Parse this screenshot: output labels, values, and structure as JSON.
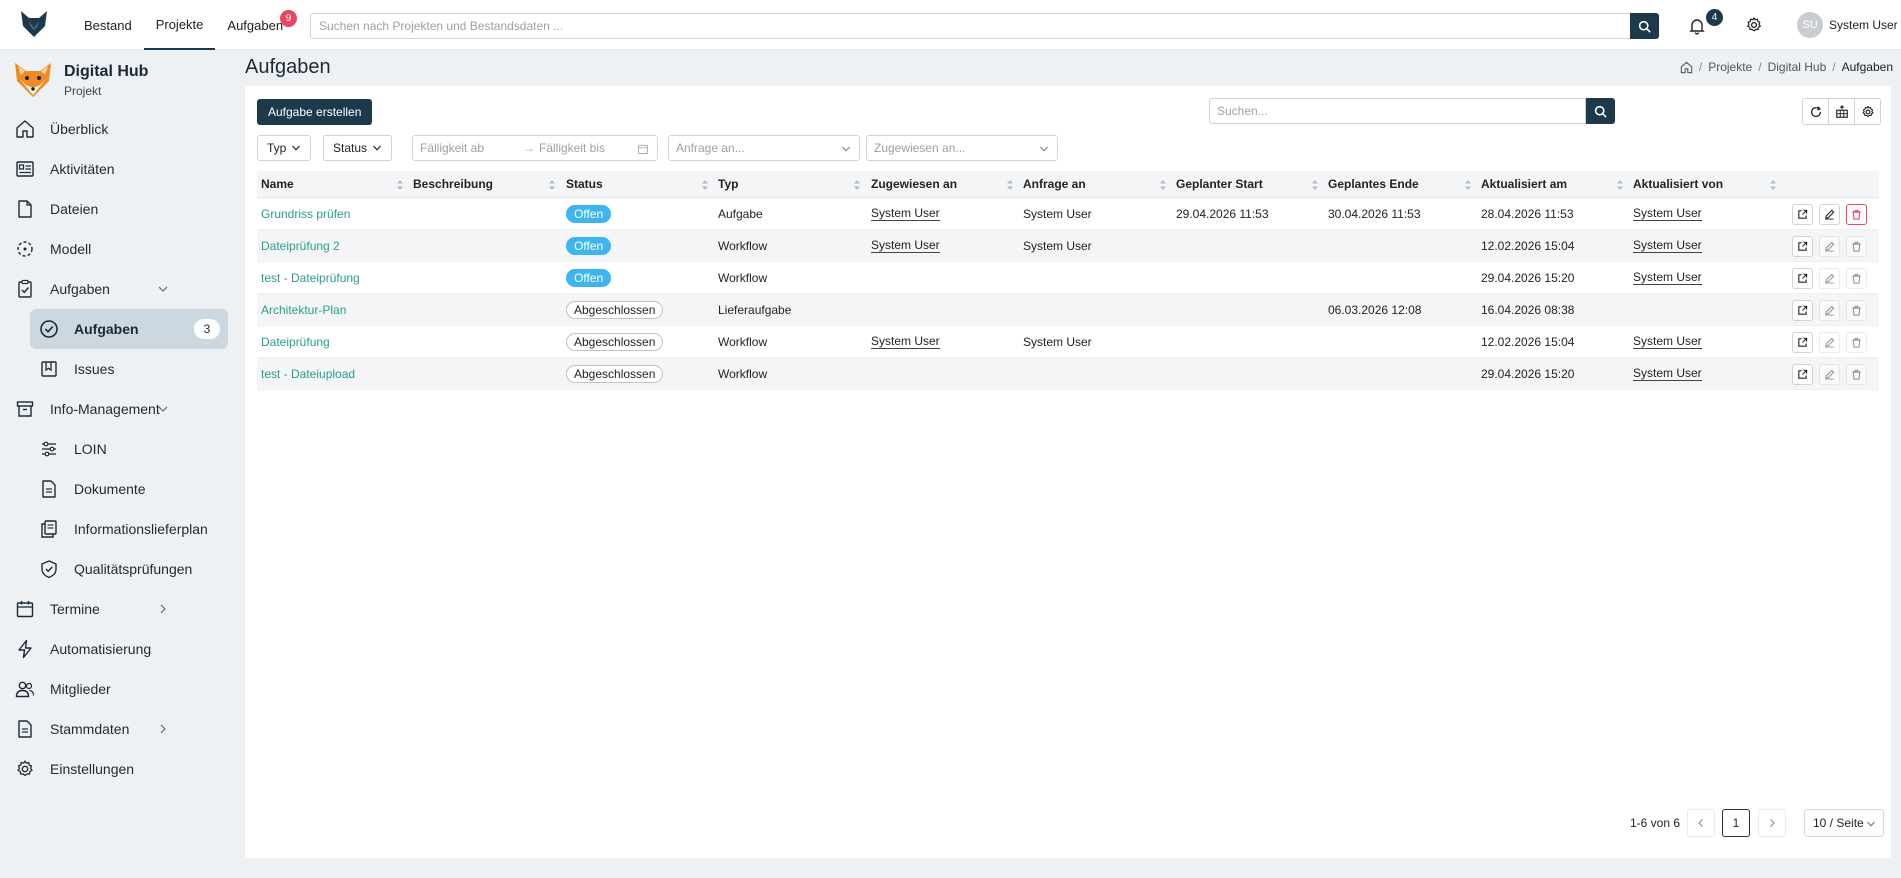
{
  "topnav": {
    "items": [
      {
        "label": "Bestand"
      },
      {
        "label": "Projekte",
        "active": true
      },
      {
        "label": "Aufgaben",
        "badge": "9"
      }
    ],
    "search_placeholder": "Suchen nach Projekten und Bestandsdaten ...",
    "notifications_count": "4",
    "user_initials": "SU",
    "user_name": "System User"
  },
  "project": {
    "title": "Digital Hub",
    "subtitle": "Projekt"
  },
  "sidebar": {
    "items": [
      {
        "label": "Überblick",
        "icon": "home-icon"
      },
      {
        "label": "Aktivitäten",
        "icon": "activity-icon"
      },
      {
        "label": "Dateien",
        "icon": "file-icon"
      },
      {
        "label": "Modell",
        "icon": "model-icon"
      },
      {
        "label": "Aufgaben",
        "icon": "clipboard-check-icon",
        "expanded": true
      },
      {
        "label": "Aufgaben",
        "icon": "check-circle-icon",
        "selected": true,
        "count": "3"
      },
      {
        "label": "Issues",
        "icon": "bookmark-icon"
      },
      {
        "label": "Info-Management",
        "icon": "archive-icon",
        "expanded": true
      },
      {
        "label": "LOIN",
        "icon": "sliders-icon"
      },
      {
        "label": "Dokumente",
        "icon": "document-icon"
      },
      {
        "label": "Informationslieferplan",
        "icon": "copy-icon"
      },
      {
        "label": "Qualitätsprüfungen",
        "icon": "shield-check-icon"
      },
      {
        "label": "Termine",
        "icon": "calendar-icon"
      },
      {
        "label": "Automatisierung",
        "icon": "bolt-icon"
      },
      {
        "label": "Mitglieder",
        "icon": "users-icon"
      },
      {
        "label": "Stammdaten",
        "icon": "document-icon"
      },
      {
        "label": "Einstellungen",
        "icon": "gear-icon"
      }
    ]
  },
  "page": {
    "title": "Aufgaben",
    "breadcrumbs": [
      "Projekte",
      "Digital Hub",
      "Aufgaben"
    ]
  },
  "toolbar": {
    "create_label": "Aufgabe erstellen",
    "search_placeholder": "Suchen..."
  },
  "filters": {
    "type_label": "Typ",
    "status_label": "Status",
    "due_from_placeholder": "Fälligkeit ab",
    "due_to_placeholder": "Fälligkeit bis",
    "requested_placeholder": "Anfrage an...",
    "assigned_placeholder": "Zugewiesen an..."
  },
  "table": {
    "columns": [
      "Name",
      "Beschreibung",
      "Status",
      "Typ",
      "Zugewiesen an",
      "Anfrage an",
      "Geplanter Start",
      "Geplantes Ende",
      "Aktualisiert am",
      "Aktualisiert von"
    ],
    "rows": [
      {
        "name": "Grundriss prüfen",
        "description": "",
        "status": "Offen",
        "type": "Aufgabe",
        "assigned": "System User",
        "requested": "System User",
        "start": "29.04.2026 11:53",
        "end": "30.04.2026 11:53",
        "updated_at": "28.04.2026 11:53",
        "updated_by": "System User",
        "editable": true
      },
      {
        "name": "Dateiprüfung 2",
        "description": "",
        "status": "Offen",
        "type": "Workflow",
        "assigned": "System User",
        "requested": "System User",
        "start": "",
        "end": "",
        "updated_at": "12.02.2026 15:04",
        "updated_by": "System User",
        "editable": false
      },
      {
        "name": "test - Dateiprüfung",
        "description": "",
        "status": "Offen",
        "type": "Workflow",
        "assigned": "",
        "requested": "",
        "start": "",
        "end": "",
        "updated_at": "29.04.2026 15:20",
        "updated_by": "System User",
        "editable": false
      },
      {
        "name": "Architektur-Plan",
        "description": "",
        "status": "Abgeschlossen",
        "type": "Lieferaufgabe",
        "assigned": "",
        "requested": "",
        "start": "",
        "end": "06.03.2026 12:08",
        "updated_at": "16.04.2026 08:38",
        "updated_by": "",
        "editable": false
      },
      {
        "name": "Dateiprüfung",
        "description": "",
        "status": "Abgeschlossen",
        "type": "Workflow",
        "assigned": "System User",
        "requested": "System User",
        "start": "",
        "end": "",
        "updated_at": "12.02.2026 15:04",
        "updated_by": "System User",
        "editable": false
      },
      {
        "name": "test - Dateiupload",
        "description": "",
        "status": "Abgeschlossen",
        "type": "Workflow",
        "assigned": "",
        "requested": "",
        "start": "",
        "end": "",
        "updated_at": "29.04.2026 15:20",
        "updated_by": "System User",
        "editable": false
      }
    ]
  },
  "pagination": {
    "summary": "1-6 von 6",
    "current_page": "1",
    "page_size": "10 / Seite"
  },
  "colors": {
    "primary": "#1d3a4c",
    "accent_link": "#2a9d8f",
    "status_open": "#3cb6ec",
    "badge_red": "#e94560",
    "delete_red": "#e84a5f"
  }
}
